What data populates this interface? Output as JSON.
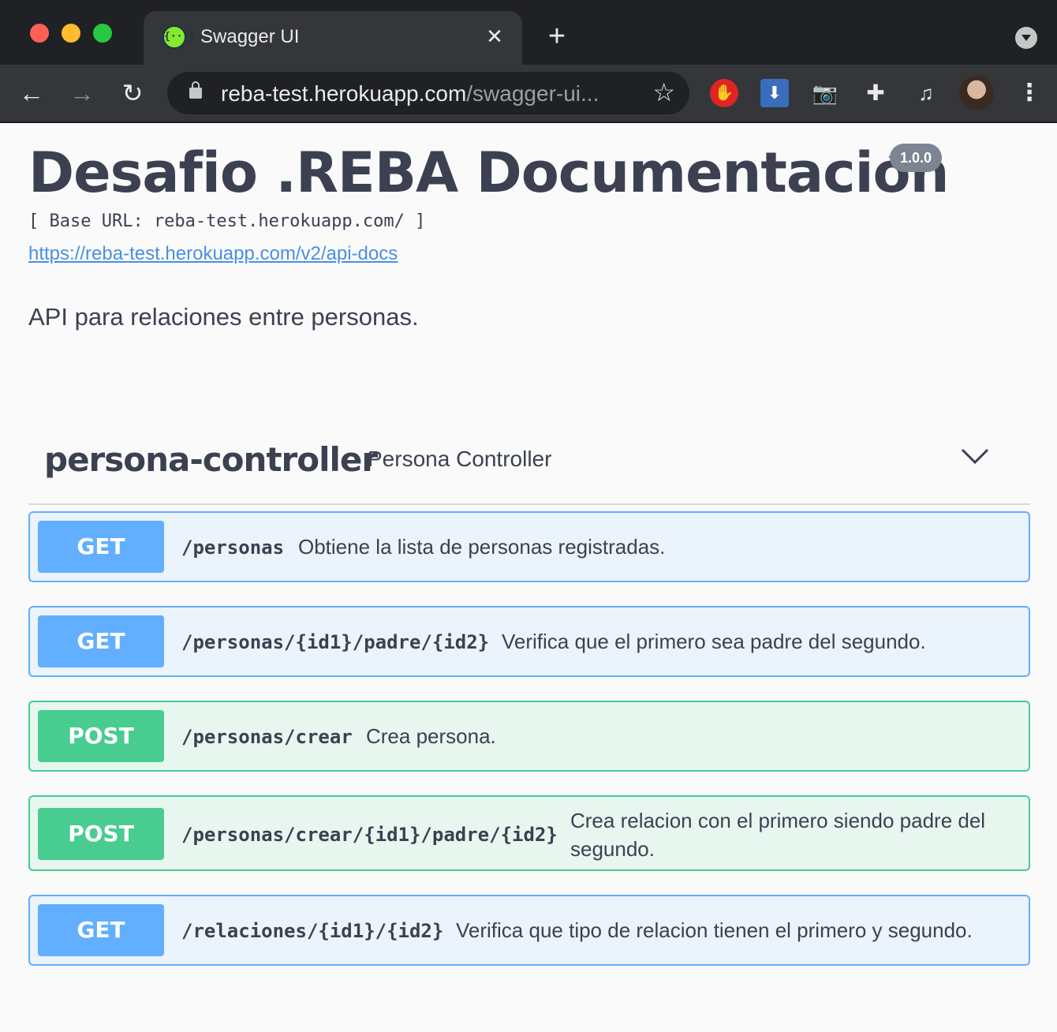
{
  "browser": {
    "tab_title": "Swagger UI",
    "favicon_text": "{···}",
    "close_glyph": "✕",
    "new_tab_glyph": "+",
    "url_host": "reba-test.herokuapp.com",
    "url_path": "/swagger-ui...",
    "star_glyph": "☆",
    "back_glyph": "←",
    "forward_glyph": "→",
    "reload_glyph": "↻",
    "menu_glyph": "⋮",
    "extensions": [
      {
        "name": "adblock-icon",
        "glyph": "✋"
      },
      {
        "name": "download-icon",
        "glyph": "⬇"
      },
      {
        "name": "camera-icon",
        "glyph": "📷"
      },
      {
        "name": "puzzle-icon",
        "glyph": "✚"
      },
      {
        "name": "media-queue-icon",
        "glyph": "♫"
      }
    ]
  },
  "info": {
    "title": "Desafio .REBA Documentación",
    "version": "1.0.0",
    "base_url": "[ Base URL: reba-test.herokuapp.com/ ]",
    "docs_link": "https://reba-test.herokuapp.com/v2/api-docs",
    "description": "API para relaciones entre personas."
  },
  "tag": {
    "name": "persona-controller",
    "description": "Persona Controller"
  },
  "operations": [
    {
      "method": "GET",
      "path": "/personas",
      "summary": "Obtiene la lista de personas registradas."
    },
    {
      "method": "GET",
      "path": "/personas/{id1}/padre/{id2}",
      "summary": "Verifica que el primero sea padre del segundo."
    },
    {
      "method": "POST",
      "path": "/personas/crear",
      "summary": "Crea persona."
    },
    {
      "method": "POST",
      "path": "/personas/crear/{id1}/padre/{id2}",
      "summary_line1": "Crea relacion con el primero siendo padre del",
      "summary_line2": "segundo."
    },
    {
      "method": "GET",
      "path": "/relaciones/{id1}/{id2}",
      "summary": "Verifica que tipo de relacion tienen el primero y segundo."
    }
  ],
  "colors": {
    "get": "#61affe",
    "post": "#49cc90"
  }
}
